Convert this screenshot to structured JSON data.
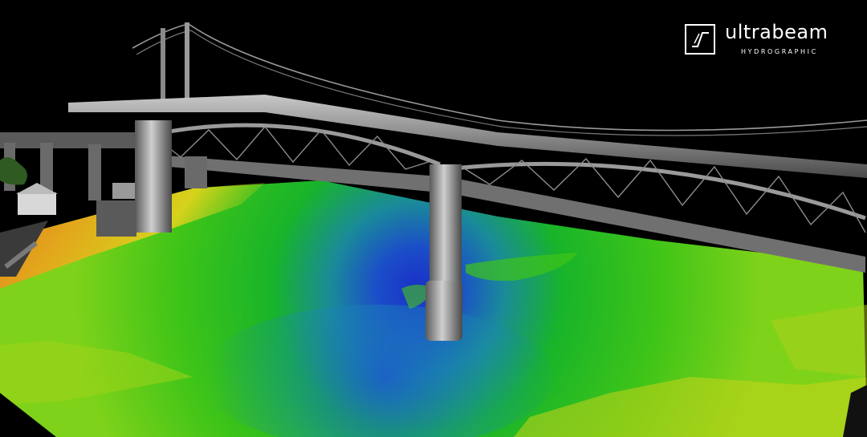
{
  "logo": {
    "name": "ultrabeam",
    "subtitle": "HYDROGRAPHIC",
    "mark_icon": "ultrabeam-logo-icon"
  },
  "colors": {
    "background": "#000000",
    "riverbed_shallow": "#e07a1a",
    "riverbed_mid": "#e0d21c",
    "riverbed_green": "#1fb81f",
    "riverbed_deep": "#1a3fc0",
    "bridge_structure": "#8a8a8a",
    "logo": "#ffffff"
  }
}
